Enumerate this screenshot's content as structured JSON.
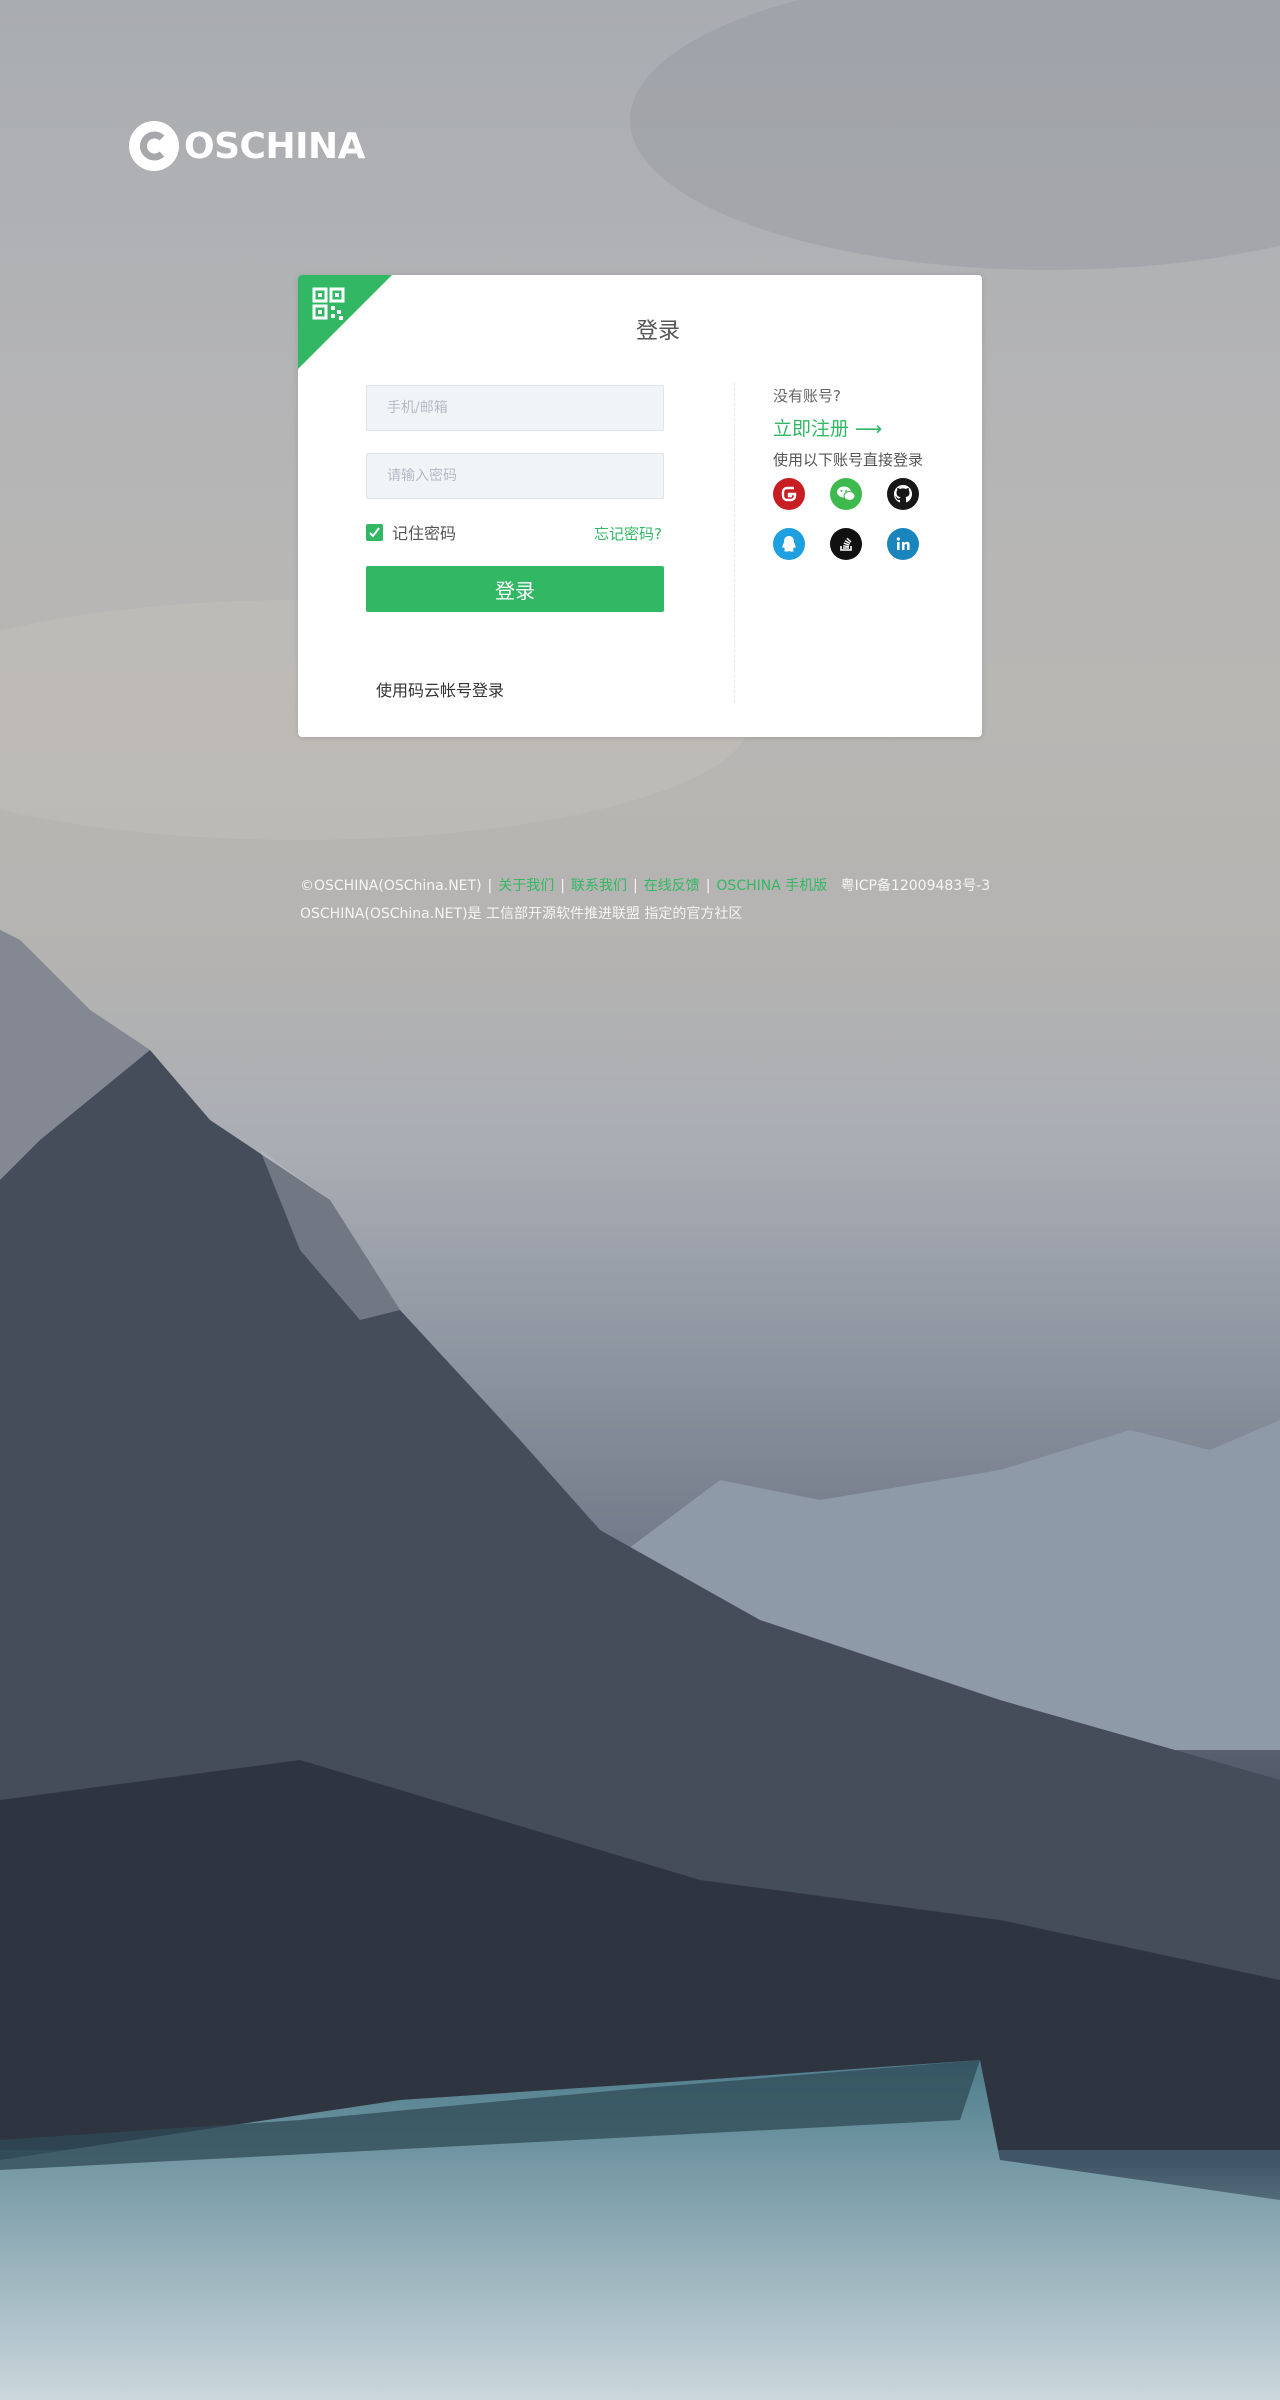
{
  "brand": {
    "name": "OSCHINA"
  },
  "login": {
    "title": "登录",
    "account_placeholder": "手机/邮箱",
    "password_placeholder": "请输入密码",
    "remember_label": "记住密码",
    "remember_checked": true,
    "forgot_label": "忘记密码?",
    "submit_label": "登录",
    "gitee_login_label": "使用码云帐号登录",
    "qr_icon": "qr-code-icon"
  },
  "register_panel": {
    "no_account_text": "没有账号?",
    "register_label": "立即注册 ⟶",
    "oauth_title": "使用以下账号直接登录",
    "oauth": [
      {
        "name": "gitee",
        "icon": "gitee-icon",
        "color": "#c71d23"
      },
      {
        "name": "wechat",
        "icon": "wechat-icon",
        "color": "#3eb94e"
      },
      {
        "name": "github",
        "icon": "github-icon",
        "color": "#181717"
      },
      {
        "name": "qq",
        "icon": "qq-icon",
        "color": "#1ea0e0"
      },
      {
        "name": "stackoverflow",
        "icon": "stackoverflow-icon",
        "color": "#111111"
      },
      {
        "name": "linkedin",
        "icon": "linkedin-icon",
        "color": "#1a84bc"
      }
    ]
  },
  "footer": {
    "copyright": "©OSCHINA(OSChina.NET)",
    "links": [
      "关于我们",
      "联系我们",
      "在线反馈",
      "OSCHINA 手机版"
    ],
    "icp": "粤ICP备12009483号-3",
    "line2": "OSCHINA(OSChina.NET)是 工信部开源软件推进联盟 指定的官方社区"
  },
  "colors": {
    "accent": "#32b864",
    "card_bg": "#ffffff"
  }
}
